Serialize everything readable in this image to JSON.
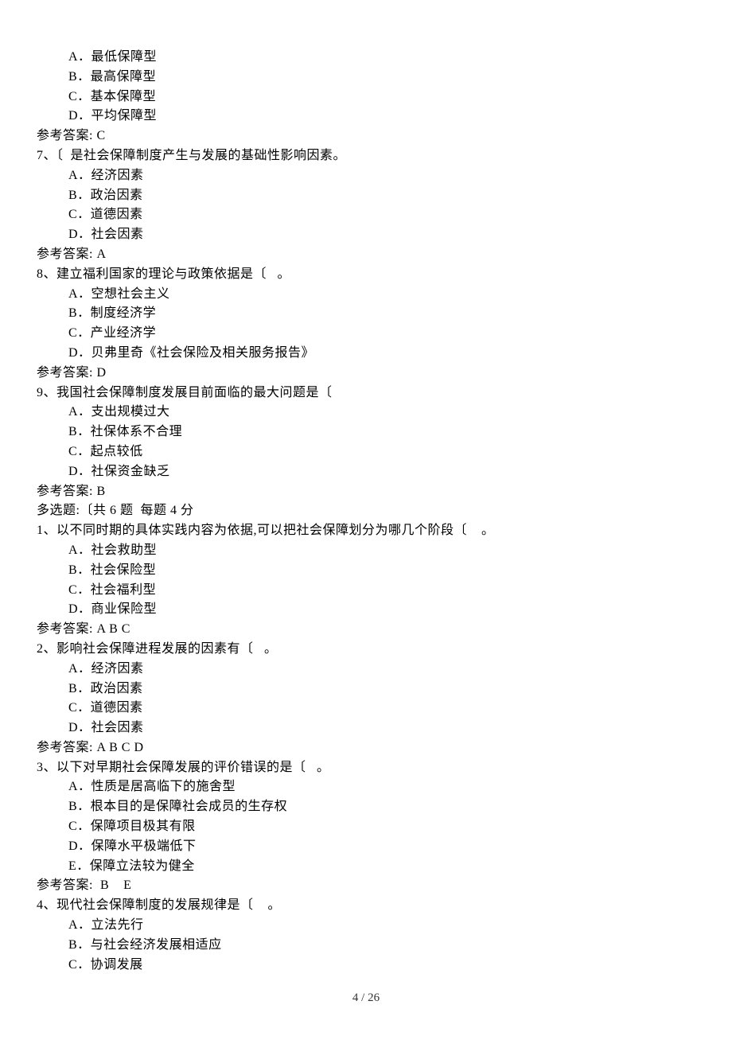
{
  "q6": {
    "opts": {
      "a": "A．最低保障型",
      "b": "B．最高保障型",
      "c": "C．基本保障型",
      "d": "D．平均保障型"
    },
    "ans": "参考答案: C"
  },
  "q7": {
    "stem": "7、〔  是社会保障制度产生与发展的基础性影响因素。",
    "opts": {
      "a": "A．经济因素",
      "b": "B．政治因素",
      "c": "C．道德因素",
      "d": "D．社会因素"
    },
    "ans": "参考答案: A"
  },
  "q8": {
    "stem": "8、建立福利国家的理论与政策依据是〔   。",
    "opts": {
      "a": "A．空想社会主义",
      "b": "B．制度经济学",
      "c": "C．产业经济学",
      "d": "D．贝弗里奇《社会保险及相关服务报告》"
    },
    "ans": "参考答案: D"
  },
  "q9": {
    "stem": "9、我国社会保障制度发展目前面临的最大问题是〔",
    "opts": {
      "a": "A．支出规模过大",
      "b": "B．社保体系不合理",
      "c": "C．起点较低",
      "d": "D．社保资金缺乏"
    },
    "ans": "参考答案: B"
  },
  "section_multi": "多选题:〔共 6 题  每题 4 分",
  "m1": {
    "stem": "1、以不同时期的具体实践内容为依据,可以把社会保障划分为哪几个阶段〔    。",
    "opts": {
      "a": "A．社会救助型",
      "b": "B．社会保险型",
      "c": "C．社会福利型",
      "d": "D．商业保险型"
    },
    "ans": "参考答案: A B C"
  },
  "m2": {
    "stem": "2、影响社会保障进程发展的因素有〔   。",
    "opts": {
      "a": "A．经济因素",
      "b": "B．政治因素",
      "c": "C．道德因素",
      "d": "D．社会因素"
    },
    "ans": "参考答案: A B C D"
  },
  "m3": {
    "stem": "3、以下对早期社会保障发展的评价错误的是〔   。",
    "opts": {
      "a": "A．性质是居高临下的施舍型",
      "b": "B．根本目的是保障社会成员的生存权",
      "c": "C．保障项目极其有限",
      "d": "D．保障水平极端低下",
      "e": "E．保障立法较为健全"
    },
    "ans": "参考答案:  B    E"
  },
  "m4": {
    "stem": "4、现代社会保障制度的发展规律是〔    。",
    "opts": {
      "a": "A．立法先行",
      "b": "B．与社会经济发展相适应",
      "c": "C．协调发展"
    }
  },
  "footer": "4  /  26"
}
